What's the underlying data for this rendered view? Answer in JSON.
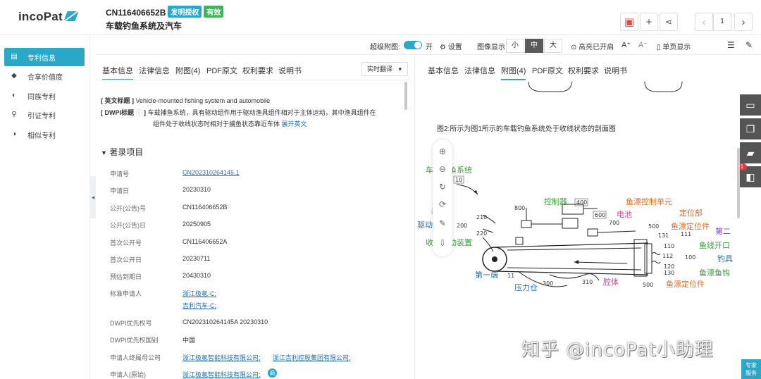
{
  "header": {
    "patent_number": "CN116406652B",
    "badge_type": "发明授权",
    "badge_status": "有效",
    "title": "车载钓鱼系统及汽车",
    "page_number": "1"
  },
  "logo": {
    "text": "incoPat"
  },
  "sidebar": {
    "items": [
      {
        "label": "专利信息",
        "icon": "doc-icon",
        "active": true
      },
      {
        "label": "合享价值度",
        "icon": "diamond-icon",
        "active": false
      },
      {
        "label": "同族专利",
        "icon": "toggle-icon",
        "active": false
      },
      {
        "label": "引证专利",
        "icon": "cite-icon",
        "active": false
      },
      {
        "label": "相似专利",
        "icon": "toggle-icon",
        "active": false
      }
    ]
  },
  "toolbar": {
    "super_figure_label": "超级附图:",
    "toggle_on_label": "开",
    "settings_label": "设置",
    "image_display_label": "图像显示",
    "size_small": "小",
    "size_medium": "中",
    "size_large": "大",
    "highlight_label": "高亮已开启",
    "font_up": "A⁺",
    "font_down": "A⁻",
    "single_page_label": "单页显示"
  },
  "left_tabs": [
    "基本信息",
    "法律信息",
    "附图(4)",
    "PDF原文",
    "权利要求",
    "说明书"
  ],
  "right_tabs": [
    "基本信息",
    "法律信息",
    "附图(4)",
    "PDF原文",
    "权利要求",
    "说明书"
  ],
  "translate_label": "实时翻译",
  "english_title": {
    "label": "[ 英文标题 ]",
    "value": "Vehicle-mounted fishing system and automobile"
  },
  "dwpi_title": {
    "label": "[ DWPI标题",
    "suffix": "]",
    "line1": "车载捕鱼系统，具有驱动组件用于驱动渔具组件相对于主体运动，其中渔具组件在",
    "line2": "组件处于收线状态时相对于捕鱼状态靠近车体",
    "expand": "展开英文"
  },
  "biblio": {
    "heading": "著录项目",
    "rows": [
      {
        "label": "申请号",
        "value": "CN202310264145.1",
        "link": true
      },
      {
        "label": "申请日",
        "value": "20230310"
      },
      {
        "label": "公开(公告)号",
        "value": "CN116406652B"
      },
      {
        "label": "公开(公告)日",
        "value": "20250905"
      },
      {
        "label": "首次公开号",
        "value": "CN116406652A"
      },
      {
        "label": "首次公开日",
        "value": "20230711"
      },
      {
        "label": "预估到期日",
        "value": "20430310"
      },
      {
        "label": "标准申请人",
        "value": "浙江极氪-C;",
        "value2": "吉利汽车-C;",
        "link": true
      },
      {
        "label": "DWPI优先权号",
        "value": "CN202310264145A 20230310"
      },
      {
        "label": "DWPI优先权国别",
        "value": "中国"
      },
      {
        "label": "申请人终属母公司",
        "value": "浙江极氪智能科技有限公司;",
        "value3": "浙江吉利控股集团有限公司;",
        "link": true
      },
      {
        "label": "申请人(原始)",
        "value": "浙江极氪智能科技有限公司;",
        "link": true,
        "tag": "商"
      }
    ]
  },
  "figure": {
    "caption": "图2:所示为图1所示的车载钓鱼系统处于收线状态的剖面图",
    "labels": {
      "system": "车载钓鱼系统",
      "system_num": "10",
      "controller": "控制器",
      "controller_num": "400",
      "fish_ctrl": "鱼漂控制单元",
      "battery": "电池",
      "battery_num": "600",
      "locator": "定位部",
      "float_locator": "鱼漂定位件",
      "second": "第二",
      "line_open": "鱼线开口",
      "hook_tool": "钓具",
      "float_hook": "鱼漂鱼钩",
      "float_locator2": "鱼漂定位件",
      "drive": "驱动",
      "device": "装置",
      "take_device": "收线驱动装置",
      "first_end": "第一端",
      "pressure": "压力仓",
      "cavity": "腔体",
      "n800": "800",
      "n210": "210",
      "n200": "200",
      "n220": "220",
      "n700": "700",
      "n500a": "500",
      "n131": "131",
      "n110": "110",
      "n111": "111",
      "n112": "112",
      "n100": "100",
      "n120": "120",
      "n130": "130",
      "n11": "11",
      "n300": "300",
      "n310": "310",
      "n500b": "500"
    }
  },
  "side_badge_count": "1",
  "expert_label_1": "专家",
  "expert_label_2": "服务",
  "watermark": "知乎 @incoPat小助理"
}
